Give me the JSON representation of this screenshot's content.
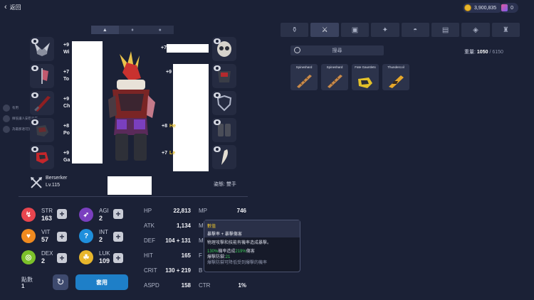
{
  "header": {
    "back_label": "返回",
    "back_icon": "chevron-left-icon"
  },
  "currency": {
    "gold": "3,900,835",
    "gems": "0"
  },
  "left_tabs": [
    "equipment-tab-icon",
    "costume-tab-icon",
    "accessory-tab-icon"
  ],
  "chat": [
    "有用",
    "揮低讓人安慰身在",
    "為最那達可於伯次"
  ],
  "equip_left": [
    {
      "plus": "+9",
      "name": "Wi",
      "icon": "winged-helmet-icon"
    },
    {
      "plus": "+7",
      "name": "To",
      "icon": "tattered-banner-icon"
    },
    {
      "plus": "+9",
      "name": "Ch",
      "icon": "greatsword-icon"
    },
    {
      "plus": "+8",
      "name": "Po",
      "icon": "gauntlet-icon"
    },
    {
      "plus": "+9",
      "name": "Ga",
      "icon": "red-gauntlet-icon"
    }
  ],
  "equip_right": [
    {
      "plus": "+7",
      "name": "",
      "icon": "skull-mask-icon"
    },
    {
      "plus": "+9",
      "name": "",
      "icon": "chest-armor-icon"
    },
    {
      "plus": "+8",
      "name": "He",
      "icon": "shield-icon"
    },
    {
      "plus": "+7",
      "name": "Le",
      "icon": "leg-armor-icon"
    },
    {
      "plus": "",
      "name": "",
      "icon": "fang-icon"
    }
  ],
  "character": {
    "class": "Berserker",
    "level": "Lv.115",
    "class_icon": "crossed-axes-icon",
    "pose_label": "姿態:",
    "pose_value": "雙手"
  },
  "stats": [
    {
      "name": "STR",
      "value": "163",
      "color": "#e8454e",
      "icon": "str-icon"
    },
    {
      "name": "AGI",
      "value": "2",
      "color": "#7a3fbf",
      "icon": "agi-icon"
    },
    {
      "name": "VIT",
      "value": "57",
      "color": "#ef8a1f",
      "icon": "vit-icon"
    },
    {
      "name": "INT",
      "value": "2",
      "color": "#1f8fdc",
      "icon": "int-icon"
    },
    {
      "name": "DEX",
      "value": "2",
      "color": "#7cc22a",
      "icon": "dex-icon"
    },
    {
      "name": "LUK",
      "value": "109",
      "color": "#e8b62c",
      "icon": "luk-icon"
    }
  ],
  "derived_left": [
    {
      "label": "HP",
      "value": "22,813"
    },
    {
      "label": "ATK",
      "value": "1,134"
    },
    {
      "label": "DEF",
      "value": "104 + 131"
    },
    {
      "label": "HIT",
      "value": "165"
    },
    {
      "label": "CRIT",
      "value": "130 + 219"
    },
    {
      "label": "ASPD",
      "value": "158"
    }
  ],
  "derived_right": [
    {
      "label": "MP",
      "value": "746"
    },
    {
      "label": "M",
      "value": ""
    },
    {
      "label": "M",
      "value": ""
    },
    {
      "label": "F",
      "value": ""
    },
    {
      "label": "B",
      "value": ""
    },
    {
      "label": "CTR",
      "value": "1%"
    }
  ],
  "points": {
    "label": "點數",
    "value": "1"
  },
  "apply_label": "套用",
  "tooltip": {
    "title": "數值",
    "subtitle": "暴擊率 + 暴擊傷害",
    "desc": "物理攻擊和技能有機率造成暴擊。",
    "line1_a": "130%",
    "line1_b": "機率造成",
    "line1_c": "219%",
    "line1_d": "傷害",
    "line2_a": "爆擊防禦:",
    "line2_b": "21",
    "line3": "爆擊防禦可降低受到爆擊的機率"
  },
  "right_tabs": [
    "potion-icon",
    "weapon-tab-icon",
    "card-tab-icon",
    "gem-tab-icon",
    "helmet-tab-icon",
    "book-tab-icon",
    "bandage-tab-icon",
    "armor-tab-icon"
  ],
  "search_placeholder": "搜尋",
  "weight": {
    "label": "重量:",
    "current": "1050",
    "max": "6150"
  },
  "items": [
    {
      "name": "Spineshard",
      "icon": "spineshard-sword-icon"
    },
    {
      "name": "Spineshard",
      "icon": "spineshard-sword-icon"
    },
    {
      "name": "Fate Gauntlets",
      "icon": "fate-gauntlets-icon"
    },
    {
      "name": "Thundercoil",
      "icon": "thundercoil-gun-icon"
    }
  ]
}
